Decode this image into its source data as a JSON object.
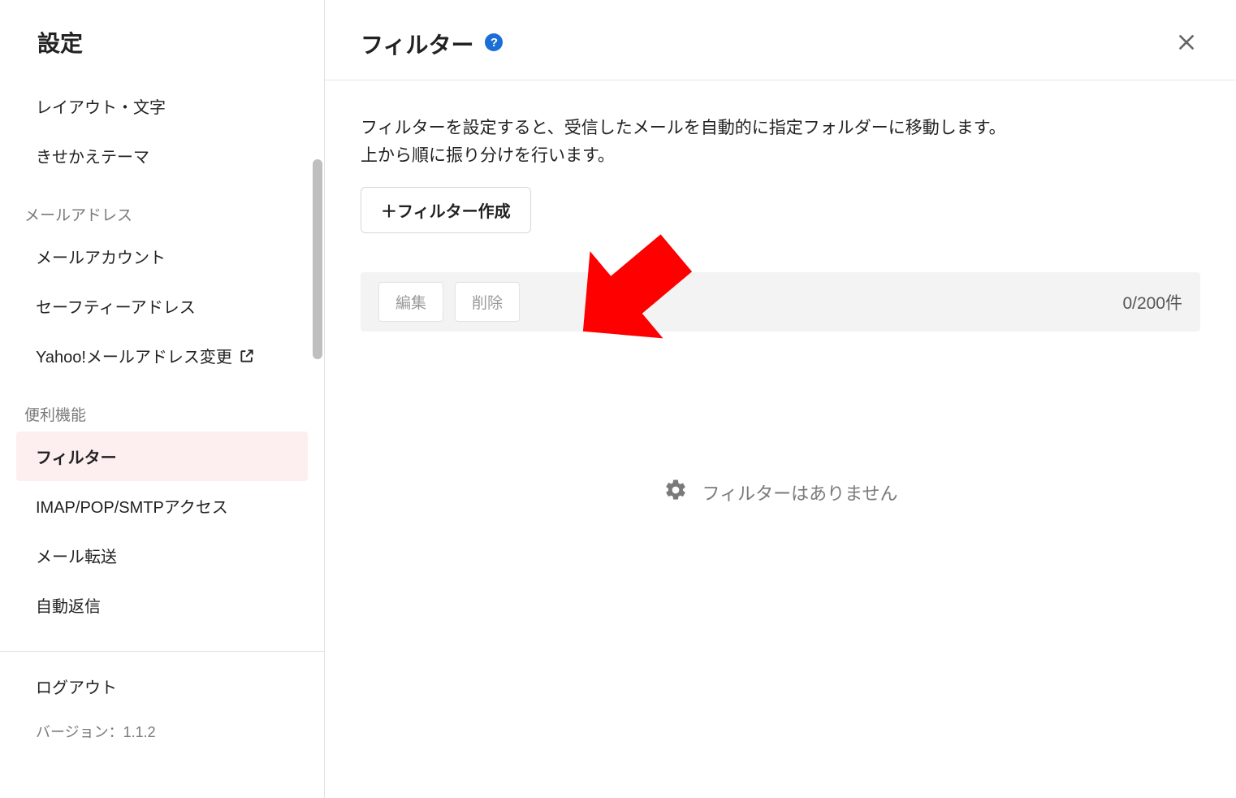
{
  "sidebar": {
    "title": "設定",
    "sections": [
      {
        "items": [
          {
            "label": "レイアウト・文字"
          },
          {
            "label": "きせかえテーマ"
          }
        ]
      },
      {
        "header": "メールアドレス",
        "items": [
          {
            "label": "メールアカウント"
          },
          {
            "label": "セーフティーアドレス"
          },
          {
            "label": "Yahoo!メールアドレス変更",
            "external": true
          }
        ]
      },
      {
        "header": "便利機能",
        "items": [
          {
            "label": "フィルター",
            "selected": true
          },
          {
            "label": "IMAP/POP/SMTPアクセス"
          },
          {
            "label": "メール転送"
          },
          {
            "label": "自動返信"
          }
        ]
      }
    ],
    "logout": "ログアウト",
    "version_label": "バージョン：1.1.2"
  },
  "main": {
    "title": "フィルター",
    "help_glyph": "?",
    "description_line1": "フィルターを設定すると、受信したメールを自動的に指定フォルダーに移動します。",
    "description_line2": "上から順に振り分けを行います。",
    "create_button": "＋フィルター作成",
    "toolbar": {
      "edit": "編集",
      "delete": "削除",
      "count": "0/200件"
    },
    "empty_message": "フィルターはありません"
  }
}
